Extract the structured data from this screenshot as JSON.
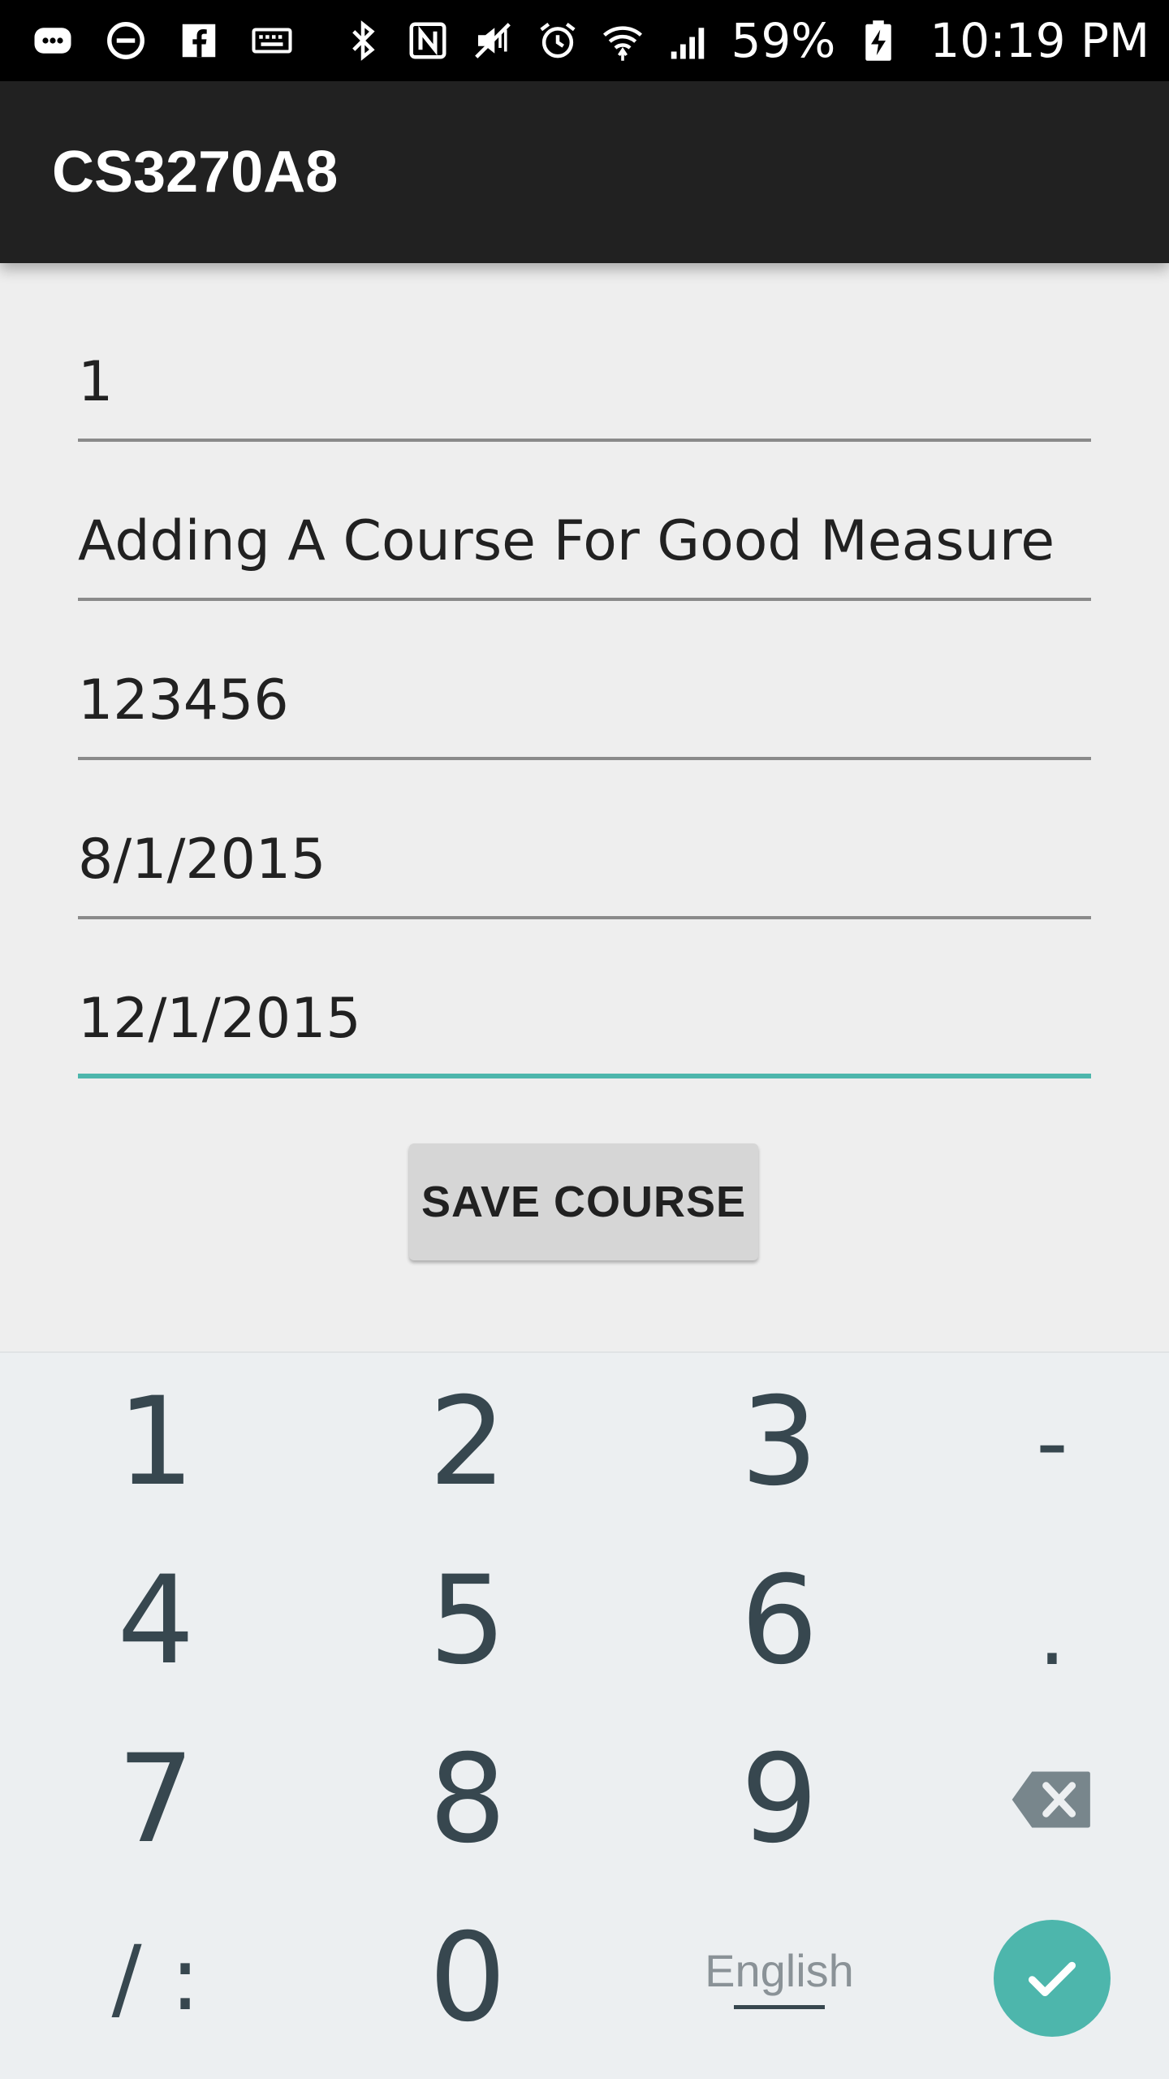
{
  "status_bar": {
    "battery": "59%",
    "time": "10:19 PM",
    "left_icons": [
      "messenger-icon",
      "do-not-disturb-icon",
      "facebook-icon",
      "keyboard-icon"
    ],
    "right_icons": [
      "bluetooth-icon",
      "nfc-icon",
      "vibrate-icon",
      "alarm-icon",
      "wifi-icon",
      "signal-icon",
      "battery-charging-icon"
    ]
  },
  "app_bar": {
    "title": "CS3270A8"
  },
  "form": {
    "fields": [
      {
        "value": "1"
      },
      {
        "value": "Adding A Course For Good Measure"
      },
      {
        "value": "123456"
      },
      {
        "value": "8/1/2015"
      },
      {
        "value": "12/1/2015",
        "focused": true
      }
    ],
    "save_label": "SAVE COURSE"
  },
  "keyboard": {
    "row1": [
      "1",
      "2",
      "3",
      "-"
    ],
    "row2": [
      "4",
      "5",
      "6",
      "."
    ],
    "row3": [
      "7",
      "8",
      "9"
    ],
    "row4": [
      "/ :",
      "0"
    ],
    "language": "English",
    "accent_color": "#4db6ac"
  }
}
